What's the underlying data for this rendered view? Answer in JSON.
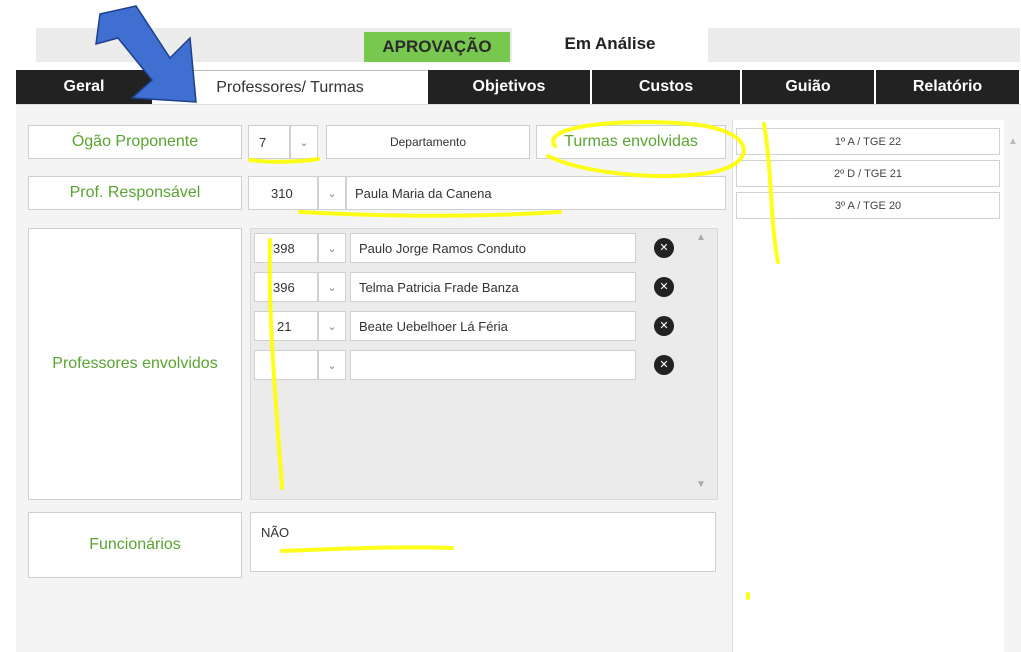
{
  "status": {
    "approval": "APROVAÇÃO",
    "analysis": "Em Análise"
  },
  "tabs": [
    {
      "label": "Geral"
    },
    {
      "label": "Professores/ Turmas"
    },
    {
      "label": "Objetivos"
    },
    {
      "label": "Custos"
    },
    {
      "label": "Guião"
    },
    {
      "label": "Relatório"
    }
  ],
  "form": {
    "orgao": {
      "label": "Ógão Proponente",
      "code": "7",
      "department": "Departamento"
    },
    "turmas_label": "Turmas envolvidas",
    "responsavel": {
      "label": "Prof. Responsável",
      "code": "310",
      "name": "Paula Maria da Canena"
    },
    "professores_label": "Professores envolvidos",
    "professores": [
      {
        "code": "398",
        "name": "Paulo Jorge Ramos Conduto"
      },
      {
        "code": "396",
        "name": "Telma Patricia Frade Banza"
      },
      {
        "code": "21",
        "name": "Beate Uebelhoer Lá Féria"
      },
      {
        "code": "",
        "name": ""
      }
    ],
    "funcionarios": {
      "label": "Funcionários",
      "value": "NÃO"
    }
  },
  "turmas": [
    "1º A / TGE 22",
    "2º D / TGE 21",
    "3º A / TGE 20"
  ],
  "colors": {
    "accent_green": "#5aa333",
    "approval_bg": "#78c850",
    "tab_dark": "#222222",
    "highlight": "#ffff00",
    "arrow": "#3f6fd0"
  }
}
